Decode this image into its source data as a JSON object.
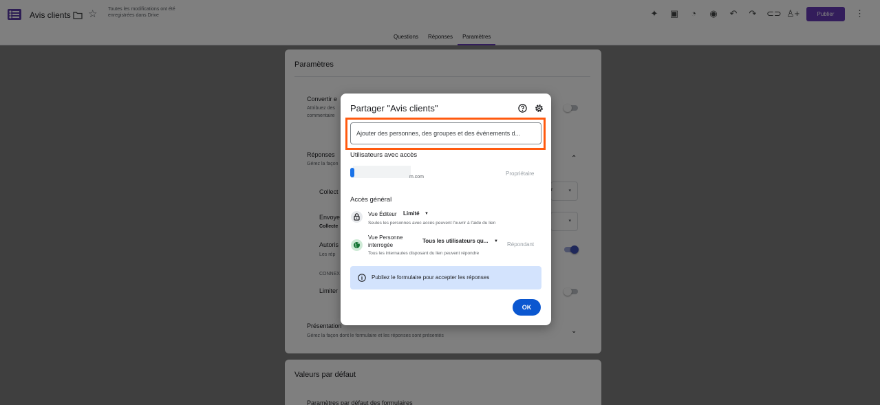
{
  "app": {
    "doc_title": "Avis clients",
    "save_status": "Toutes les modifications ont été enregistrées dans Drive",
    "publish_label": "Publier",
    "brand_color": "#673ab7"
  },
  "toolbar_icons": [
    "addons-icon",
    "customize-theme-icon",
    "palette-icon",
    "preview-icon",
    "undo-icon",
    "redo-icon",
    "link-icon",
    "add-collaborator-icon"
  ],
  "tabs": [
    {
      "label": "Questions",
      "active": false
    },
    {
      "label": "Réponses",
      "active": false
    },
    {
      "label": "Paramètres",
      "active": true
    }
  ],
  "settings": {
    "title": "Paramètres",
    "convert_label": "Convertir e",
    "convert_sub1": "Attribuez des",
    "convert_sub2": "commentaire",
    "responses_label": "Réponses",
    "responses_sub": "Gérez la façon",
    "collect_label": "Collect",
    "collect_dd_text": "r",
    "send_label": "Envoye",
    "send_sub": "Collecte",
    "allow_label": "Autoris",
    "allow_sub": "Les rép",
    "connexion_label": "CONNEX",
    "limit_label": "Limiter",
    "presentation_label": "Présentation",
    "presentation_sub": "Gérez la façon dont le formulaire et les réponses sont présentés",
    "defaults_title": "Valeurs par défaut",
    "defaults_sub": "Paramètres par défaut des formulaires"
  },
  "share_dialog": {
    "title": "Partager \"Avis clients\"",
    "input_placeholder": "Ajouter des personnes, des groupes et des événements d...",
    "users_title": "Utilisateurs avec accès",
    "user_email_suffix": "m.com",
    "user_role": "Propriétaire",
    "general_title": "Accès général",
    "editor_view_label": "Vue Éditeur",
    "editor_access_value": "Limité",
    "editor_access_desc": "Seules les personnes avec accès peuvent l'ouvrir à l'aide du lien",
    "respondent_view_label_1": "Vue Personne",
    "respondent_view_label_2": "interrogée",
    "respondent_access_value": "Tous les utilisateurs qu...",
    "respondent_role": "Répondant",
    "respondent_access_desc": "Tous les internautes disposant du lien peuvent répondre",
    "info_text": "Publiez le formulaire pour accepter les réponses",
    "ok_label": "OK",
    "highlight_color": "#ff5a0f"
  }
}
